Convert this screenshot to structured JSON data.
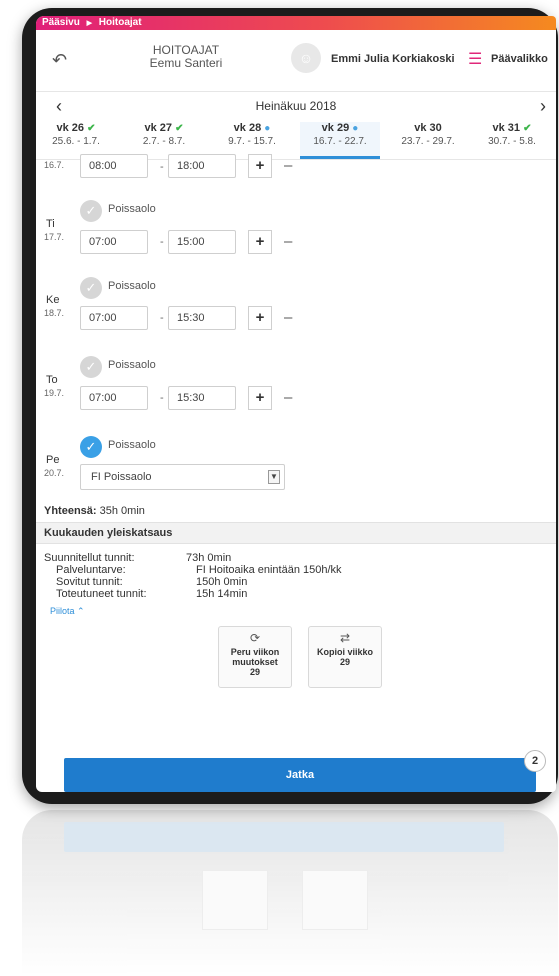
{
  "breadcrumb": {
    "home": "Pääsivu",
    "separator": "▶",
    "current": "Hoitoajat"
  },
  "header": {
    "title": "HOITOAJAT",
    "child_name": "Eemu Santeri",
    "user_name": "Emmi Julia Korkiakoski",
    "menu_label": "Päävalikko"
  },
  "calendar": {
    "month_label": "Heinäkuu 2018",
    "weeks": [
      {
        "label": "vk 26",
        "dates": "25.6. - 1.7.",
        "status": "ok"
      },
      {
        "label": "vk 27",
        "dates": "2.7. - 8.7.",
        "status": "ok"
      },
      {
        "label": "vk 28",
        "dates": "9.7. - 15.7.",
        "status": "dot"
      },
      {
        "label": "vk 29",
        "dates": "16.7. - 22.7.",
        "status": "dot"
      },
      {
        "label": "vk 30",
        "dates": "23.7. - 29.7.",
        "status": ""
      },
      {
        "label": "vk 31",
        "dates": "30.7. - 5.8.",
        "status": "ok"
      }
    ],
    "selected_week": "vk 29"
  },
  "days": {
    "partial": {
      "date": "16.7.",
      "start": "08:00",
      "end": "18:00"
    },
    "tue": {
      "day": "Ti",
      "date": "17.7.",
      "absence_label": "Poissaolo",
      "start": "07:00",
      "end": "15:00"
    },
    "wed": {
      "day": "Ke",
      "date": "18.7.",
      "absence_label": "Poissaolo",
      "start": "07:00",
      "end": "15:30"
    },
    "thu": {
      "day": "To",
      "date": "19.7.",
      "absence_label": "Poissaolo",
      "start": "07:00",
      "end": "15:30"
    },
    "fri": {
      "day": "Pe",
      "date": "20.7.",
      "absence_label": "Poissaolo",
      "absence_value": "FI Poissaolo"
    },
    "separator": "-"
  },
  "total": {
    "label": "Yhteensä:",
    "value": "35h 0min"
  },
  "overview": {
    "title": "Kuukauden yleiskatsaus",
    "planned_label": "Suunnitellut tunnit:",
    "planned_value": "73h 0min",
    "service_label": "Palveluntarve:",
    "service_value": "FI Hoitoaika enintään 150h/kk",
    "agreed_label": "Sovitut tunnit:",
    "agreed_value": "150h 0min",
    "realized_label": "Toteutuneet tunnit:",
    "realized_value": "15h 14min",
    "hide_label": "Piilota"
  },
  "actions": {
    "undo_label": "Peru viikon muutokset",
    "undo_week": "29",
    "copy_label": "Kopioi viikko",
    "copy_week": "29",
    "continue_label": "Jatka",
    "badge_count": "2"
  },
  "colors": {
    "accent": "#1f7ccd",
    "brand_pink": "#e01f7a",
    "brand_orange": "#f58a1f",
    "ok_green": "#3cb54a"
  }
}
